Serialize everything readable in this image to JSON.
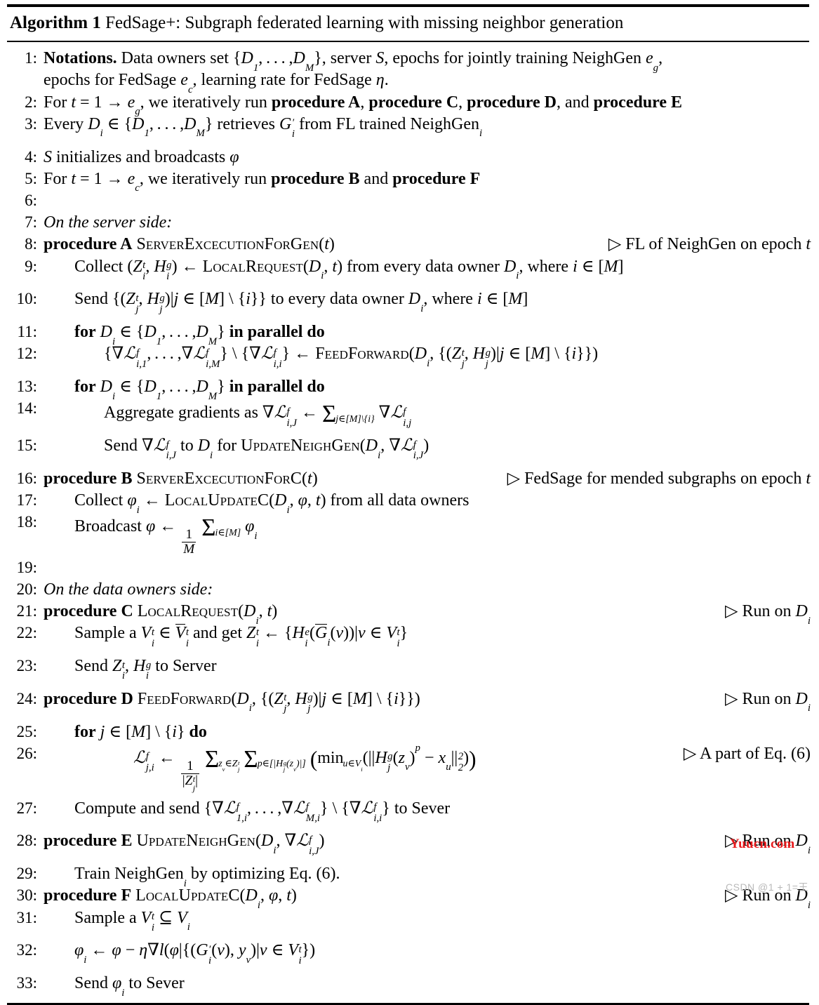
{
  "document": {
    "type": "algorithm-pseudocode",
    "title_prefix": "Algorithm 1",
    "title_text": "FedSage+: Subgraph federated learning with missing neighbor generation"
  },
  "watermarks": {
    "site": "Yuucn.com",
    "site_color": "#e8191b",
    "csdn": "CSDN @1 + 1=王",
    "csdn_color": "#b9b9b9"
  },
  "lines": [
    {
      "n": "1:",
      "indent": 1,
      "text_plain": "Notations. Data owners set {D_1,...,D_M}, server S, epochs for jointly training NeighGen e_g, epochs for FedSage e_c, learning rate for FedSage η."
    },
    {
      "n": "2:",
      "indent": 1,
      "text_plain": "For t = 1 → e_g, we iteratively run procedure A, procedure C, procedure D, and procedure E"
    },
    {
      "n": "3:",
      "indent": 1,
      "text_plain": "Every D_i ∈ {D_1,...,D_M} retrieves G'_i from FL trained NeighGen_i"
    },
    {
      "n": "4:",
      "indent": 1,
      "text_plain": "S initializes and broadcasts φ"
    },
    {
      "n": "5:",
      "indent": 1,
      "text_plain": "For t = 1 → e_c, we iteratively run procedure B and procedure F"
    },
    {
      "n": "6:",
      "indent": 1,
      "text_plain": ""
    },
    {
      "n": "7:",
      "indent": 1,
      "text_plain": "On the server side:"
    },
    {
      "n": "8:",
      "indent": 1,
      "text_plain": "procedure A SERVEREXCECUTIONFORGEN(t)",
      "comment": "▷ FL of NeighGen on epoch t"
    },
    {
      "n": "9:",
      "indent": 2,
      "text_plain": "Collect (Z_i^t, H_i^g) ← LOCALREQUEST(D_i, t) from every data owner D_i, where i ∈ [M]"
    },
    {
      "n": "10:",
      "indent": 2,
      "text_plain": "Send {(Z_j^t, H_j^g)|j ∈ [M] \\ {i}} to every data owner D_i, where i ∈ [M]"
    },
    {
      "n": "11:",
      "indent": 2,
      "text_plain": "for D_i ∈ {D_1,...,D_M} in parallel do"
    },
    {
      "n": "12:",
      "indent": 3,
      "text_plain": "{∇L_{i,1}^f,...,∇L_{i,M}^f} \\ {∇L_{i,i}^f} ← FEEDFORWARD(D_i, {(Z_j^t, H_j^g)|j ∈ [M] \\ {i}})"
    },
    {
      "n": "13:",
      "indent": 2,
      "text_plain": "for D_i ∈ {D_1,...,D_M} in parallel do"
    },
    {
      "n": "14:",
      "indent": 3,
      "text_plain": "Aggregate gradients as ∇L_{i,J}^f ← Σ_{j∈[M]\\{i}} ∇L_{i,j}^f"
    },
    {
      "n": "15:",
      "indent": 3,
      "text_plain": "Send ∇L_{i,J}^f to D_i for UPDATENEIGHGEN(D_i, ∇L_{i,J}^f)"
    },
    {
      "n": "16:",
      "indent": 1,
      "text_plain": "procedure B SERVEREXCECUTIONFORC(t)",
      "comment": "▷ FedSage for mended subgraphs on epoch t"
    },
    {
      "n": "17:",
      "indent": 2,
      "text_plain": "Collect φ_i ← LOCALUPDATEC(D_i, φ, t) from all data owners"
    },
    {
      "n": "18:",
      "indent": 2,
      "text_plain": "Broadcast φ ← (1/M) Σ_{i∈[M]} φ_i"
    },
    {
      "n": "19:",
      "indent": 1,
      "text_plain": ""
    },
    {
      "n": "20:",
      "indent": 1,
      "text_plain": "On the data owners side:"
    },
    {
      "n": "21:",
      "indent": 1,
      "text_plain": "procedure C LOCALREQUEST(D_i, t)",
      "comment": "▷ Run on D_i"
    },
    {
      "n": "22:",
      "indent": 2,
      "text_plain": "Sample a V_i^t ∈ V̄_i^t and get Z_i^t ← {H_i^e(Ḡ_i(v))|v ∈ V_i^t}"
    },
    {
      "n": "23:",
      "indent": 2,
      "text_plain": "Send Z_i^t, H_i^g to Server"
    },
    {
      "n": "24:",
      "indent": 1,
      "text_plain": "procedure D FEEDFORWARD(D_i, {(Z_j^t, H_j^g)|j ∈ [M] \\ {i}})",
      "comment": "▷ Run on D_i"
    },
    {
      "n": "25:",
      "indent": 2,
      "text_plain": "for j ∈ [M] \\ {i} do"
    },
    {
      "n": "26:",
      "indent": 3,
      "text_plain": "L_{j,i}^f ← (1/|Z_j^t|) Σ_{z_v∈Z_j^t} Σ_{p∈[|H_j^g(z_v)|]} (min_{u∈V_i}(||H_j^g(z_v)^p − x_u||_2^2))",
      "comment": "▷ A part of Eq. (6)"
    },
    {
      "n": "27:",
      "indent": 2,
      "text_plain": "Compute and send {∇L_{1,i}^f,...,∇L_{M,i}^f} \\ {∇L_{i,i}^f} to Sever"
    },
    {
      "n": "28:",
      "indent": 1,
      "text_plain": "procedure E UPDATENEIGHGEN(D_i, ∇L_{i,J}^f)",
      "comment": "▷ Run on D_i"
    },
    {
      "n": "29:",
      "indent": 2,
      "text_plain": "Train NeighGen_i by optimizing Eq. (6)."
    },
    {
      "n": "30:",
      "indent": 1,
      "text_plain": "procedure F LOCALUPDATEC(D_i, φ, t)",
      "comment": "▷ Run on D_i"
    },
    {
      "n": "31:",
      "indent": 2,
      "text_plain": "Sample a V_i^t ⊆ V_i"
    },
    {
      "n": "32:",
      "indent": 2,
      "text_plain": "φ_i ← φ − η∇l(φ|{(G'_i(v), y_v)|v ∈ V_i^t})"
    },
    {
      "n": "33:",
      "indent": 2,
      "text_plain": "Send φ_i to Sever"
    }
  ],
  "line_numbers": [
    "1:",
    "2:",
    "3:",
    "4:",
    "5:",
    "6:",
    "7:",
    "8:",
    "9:",
    "10:",
    "11:",
    "12:",
    "13:",
    "14:",
    "15:",
    "16:",
    "17:",
    "18:",
    "19:",
    "20:",
    "21:",
    "22:",
    "23:",
    "24:",
    "25:",
    "26:",
    "27:",
    "28:",
    "29:",
    "30:",
    "31:",
    "32:",
    "33:"
  ],
  "comments": {
    "c8": "▷ FL of NeighGen on epoch t",
    "c16": "▷ FedSage for mended subgraphs on epoch t",
    "c21": "▷ Run on D",
    "c24": "▷ Run on D",
    "c26": "▷ A part of Eq. (6)",
    "c28": "▷ Run on D",
    "c30": "▷ Run on D"
  },
  "keywords": {
    "notations": "Notations.",
    "procedure": "procedure",
    "for": "for",
    "do": "do",
    "in_parallel": "in parallel",
    "proc_a": "A",
    "proc_b": "B",
    "proc_c": "C",
    "proc_d": "D",
    "proc_e": "E",
    "proc_f": "F"
  },
  "section_headers": {
    "server": "On the server side:",
    "owners": "On the data owners side:"
  },
  "procedure_names": {
    "server_exec_gen": "ServerExcecutionForGen",
    "server_exec_c": "ServerExcecutionForC",
    "local_request": "LocalRequest",
    "feed_forward": "FeedForward",
    "update_neighgen": "UpdateNeighGen",
    "local_update_c": "LocalUpdateC"
  }
}
